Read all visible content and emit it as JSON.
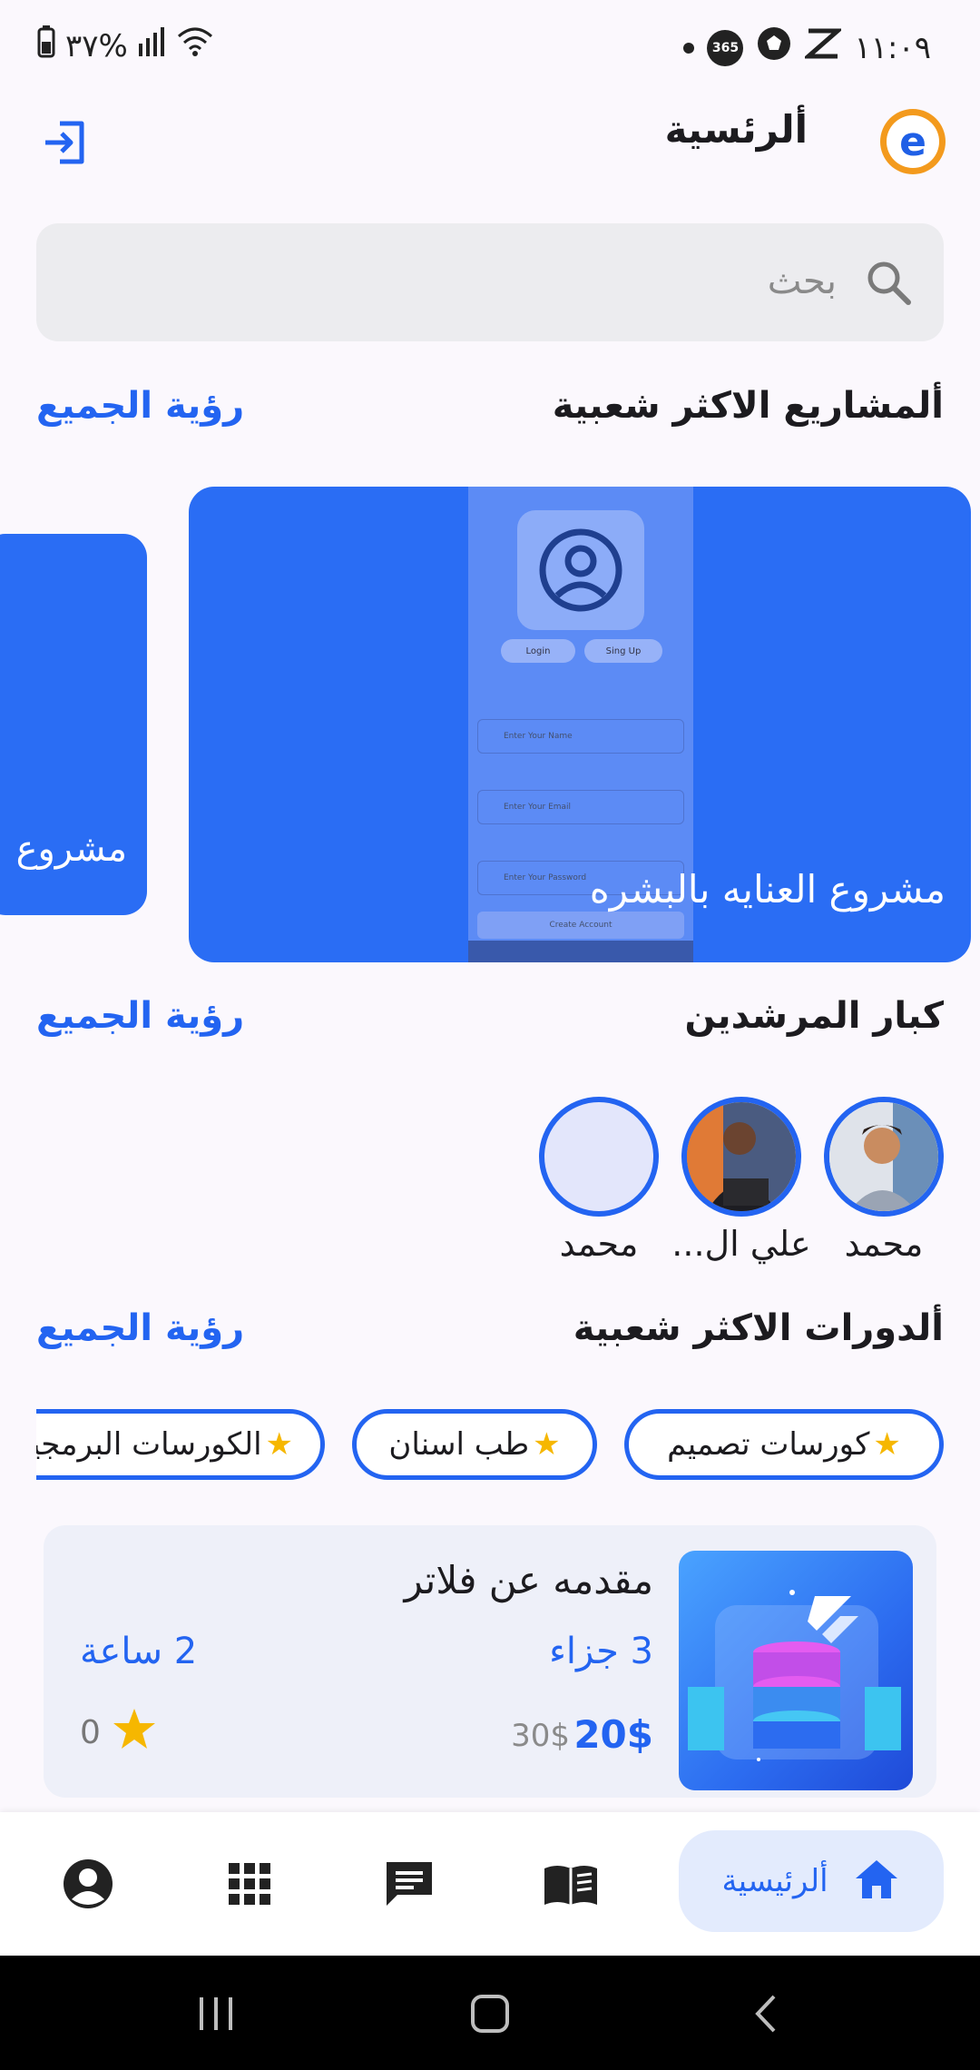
{
  "status_bar": {
    "battery": "٣٧%",
    "time": "١١:٠٩",
    "badge_365": "365"
  },
  "header": {
    "title": "ألرئسية",
    "logo_letter": "e"
  },
  "search": {
    "placeholder": "بحث"
  },
  "projects": {
    "title": "ألمشاريع الاكثر شعبية",
    "see_all": "رؤية الجميع",
    "items": [
      {
        "label": "مشروع العنايه بالبشره"
      },
      {
        "label": "مشروع"
      }
    ],
    "preview": {
      "tab_login": "Login",
      "tab_signup": "Sing Up",
      "field_name": "Enter Your Name",
      "field_email": "Enter Your Email",
      "field_password": "Enter Your Password",
      "button": "Create Account"
    }
  },
  "mentors": {
    "title": "كبار المرشدين",
    "see_all": "رؤية الجميع",
    "items": [
      {
        "name": "محمد"
      },
      {
        "name": "علي ال..."
      },
      {
        "name": "محمد"
      }
    ]
  },
  "courses": {
    "title": "ألدورات الاكثر شعبية",
    "see_all": "رؤية الجميع",
    "categories": [
      {
        "label": "كورسات تصميم"
      },
      {
        "label": "طب اسنان"
      },
      {
        "label": "الكورسات البرمجية"
      }
    ],
    "card": {
      "title": "مقدمه عن فلاتر",
      "parts": "3 جزاء",
      "hours": "2 ساعة",
      "price": "20$",
      "old_price": "30$",
      "rating": "0"
    }
  },
  "bottom_nav": {
    "home_label": "ألرئيسية"
  },
  "colors": {
    "accent": "#2364f1",
    "card_blue": "#2a6df4",
    "star": "#f6b700"
  }
}
